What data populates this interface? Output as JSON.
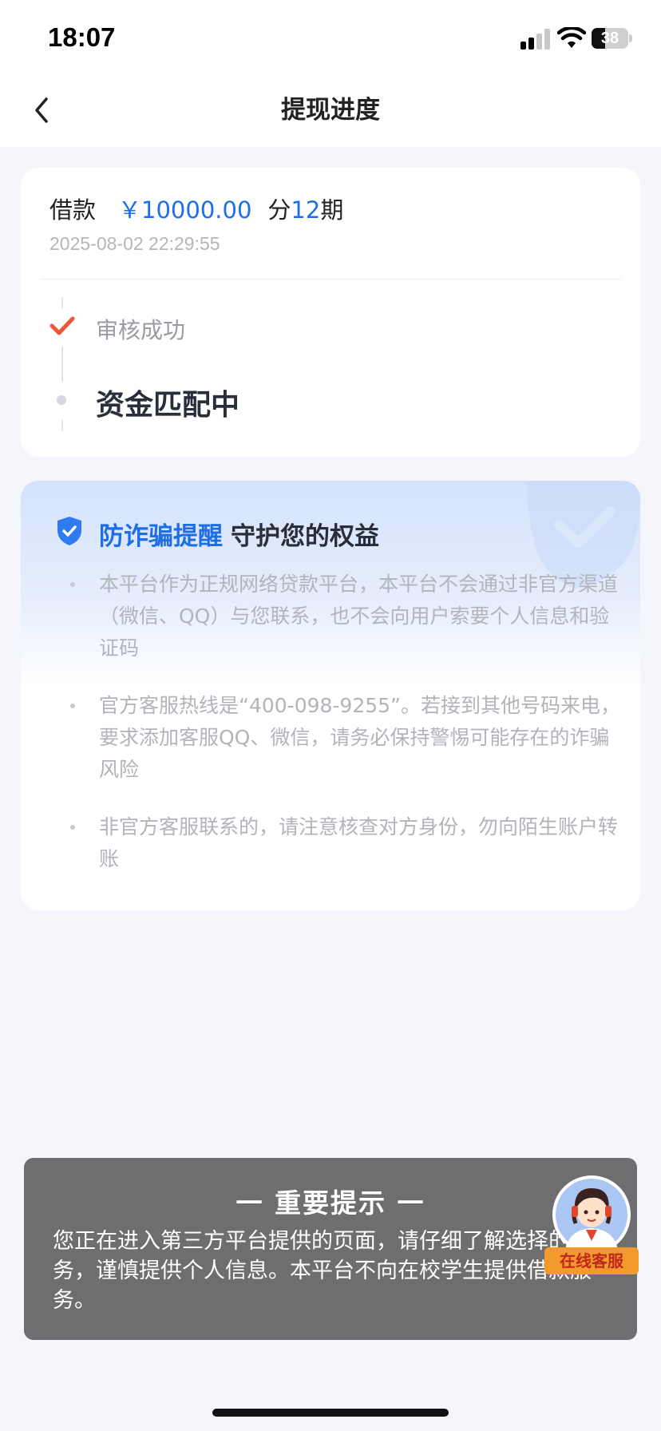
{
  "status_bar": {
    "time": "18:07",
    "battery_level": "38",
    "battery_fraction": 0.38,
    "icons": [
      "signal-icon",
      "wifi-icon",
      "battery-icon"
    ]
  },
  "nav": {
    "title": "提现进度",
    "back_icon": "chevron-left-icon"
  },
  "loan": {
    "label": "借款",
    "amount": "￥10000.00",
    "installment_prefix": "分",
    "installment_count": "12",
    "installment_suffix": "期",
    "datetime": "2025-08-02 22:29:55",
    "steps": [
      {
        "label": "审核成功",
        "status": "done"
      },
      {
        "label": "资金匹配中",
        "status": "current"
      }
    ]
  },
  "fraud": {
    "title_highlight": "防诈骗提醒",
    "title_rest": "守护您的权益",
    "items": [
      "本平台作为正规网络贷款平台，本平台不会通过非官方渠道（微信、QQ）与您联系，也不会向用户索要个人信息和验证码",
      "官方客服热线是“400-098-9255”。若接到其他号码来电，要求添加客服QQ、微信，请务必保持警惕可能存在的诈骗风险",
      "非官方客服联系的，请注意核查对方身份，勿向陌生账户转账"
    ]
  },
  "notice": {
    "title": "一  重要提示  一",
    "body": "您正在进入第三方平台提供的页面，请仔细了解选择的服务，谨慎提供个人信息。本平台不向在校学生提供借款服务。"
  },
  "support": {
    "label": "在线客服"
  },
  "colors": {
    "accent": "#1e6ee8",
    "success": "#f0573a",
    "notice_bg": "#6e6e70",
    "support_bg": "#f39a2c"
  }
}
